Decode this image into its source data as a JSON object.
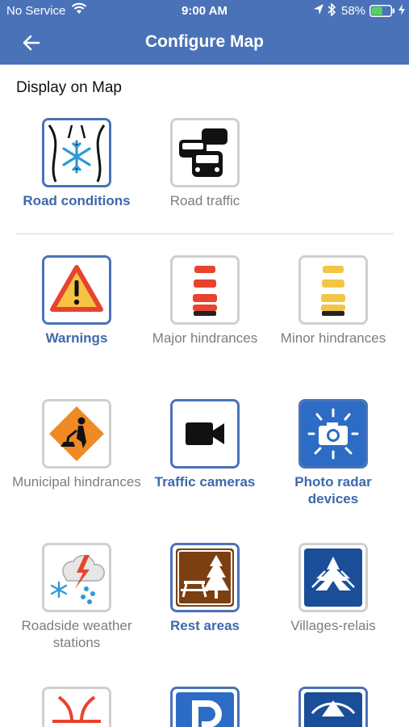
{
  "status_bar": {
    "carrier": "No Service",
    "time": "9:00 AM",
    "battery": "58%",
    "battery_level": 0.58
  },
  "header": {
    "title": "Configure Map",
    "back_icon": "arrow-left-icon"
  },
  "section": {
    "title": "Display on Map"
  },
  "layers": [
    {
      "label": "Road conditions",
      "selected": true,
      "icon": "road-conditions-icon"
    },
    {
      "label": "Road traffic",
      "selected": false,
      "icon": "road-traffic-icon"
    },
    {
      "label": "Warnings",
      "selected": true,
      "icon": "warning-triangle-icon"
    },
    {
      "label": "Major hindrances",
      "selected": false,
      "icon": "red-barrel-icon"
    },
    {
      "label": "Minor hindrances",
      "selected": false,
      "icon": "yellow-barrel-icon"
    },
    {
      "label": "Municipal hindrances",
      "selected": false,
      "icon": "roadwork-sign-icon"
    },
    {
      "label": "Traffic cameras",
      "selected": true,
      "icon": "video-camera-icon"
    },
    {
      "label": "Photo radar devices",
      "selected": true,
      "icon": "photo-radar-icon"
    },
    {
      "label": "Roadside weather stations",
      "selected": false,
      "icon": "weather-station-icon"
    },
    {
      "label": "Rest areas",
      "selected": true,
      "icon": "rest-area-icon"
    },
    {
      "label": "Villages-relais",
      "selected": false,
      "icon": "villages-relais-icon"
    },
    {
      "label": "",
      "selected": false,
      "icon": "interchange-icon"
    },
    {
      "label": "",
      "selected": true,
      "icon": "parking-icon"
    },
    {
      "label": "",
      "selected": true,
      "icon": "blue-sign-icon"
    }
  ],
  "colors": {
    "header": "#4a72b8",
    "selected": "#3d68ad",
    "unselected_border": "#cfcfcf",
    "unselected_text": "#7d7d7d"
  }
}
